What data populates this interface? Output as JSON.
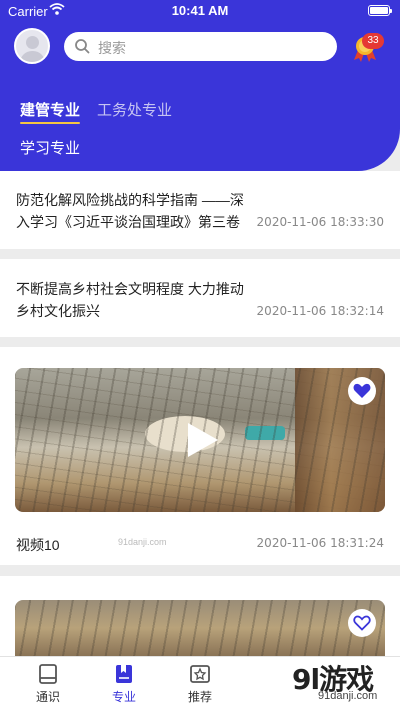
{
  "status_bar": {
    "carrier": "Carrier",
    "time": "10:41 AM"
  },
  "search": {
    "placeholder": "搜索"
  },
  "notification": {
    "count": "33"
  },
  "tabs": [
    {
      "label": "建管专业",
      "active": true
    },
    {
      "label": "工务处专业",
      "active": false
    },
    {
      "label": "学习专业",
      "active": false
    }
  ],
  "feed": [
    {
      "type": "article",
      "title": "防范化解风险挑战的科学指南 ——深入学习《习近平谈治国理政》第三卷",
      "time": "2020-11-06 18:33:30"
    },
    {
      "type": "article",
      "title": "不断提高乡村社会文明程度 大力推动乡村文化振兴",
      "time": "2020-11-06 18:32:14"
    },
    {
      "type": "video",
      "title": "视频10",
      "time": "2020-11-06 18:31:24",
      "favorited": true
    },
    {
      "type": "video",
      "title": "",
      "time": "",
      "favorited": false
    }
  ],
  "tabbar": [
    {
      "label": "通识",
      "icon": "book-icon",
      "active": false
    },
    {
      "label": "专业",
      "icon": "bookmark-book-icon",
      "active": true
    },
    {
      "label": "推荐",
      "icon": "star-image-icon",
      "active": false
    }
  ],
  "watermark": {
    "brand": "9l游戏",
    "site": "91danji.com"
  },
  "colors": {
    "primary": "#3a35d9",
    "badge": "#e53935",
    "tab_underline": "#f4c542"
  }
}
